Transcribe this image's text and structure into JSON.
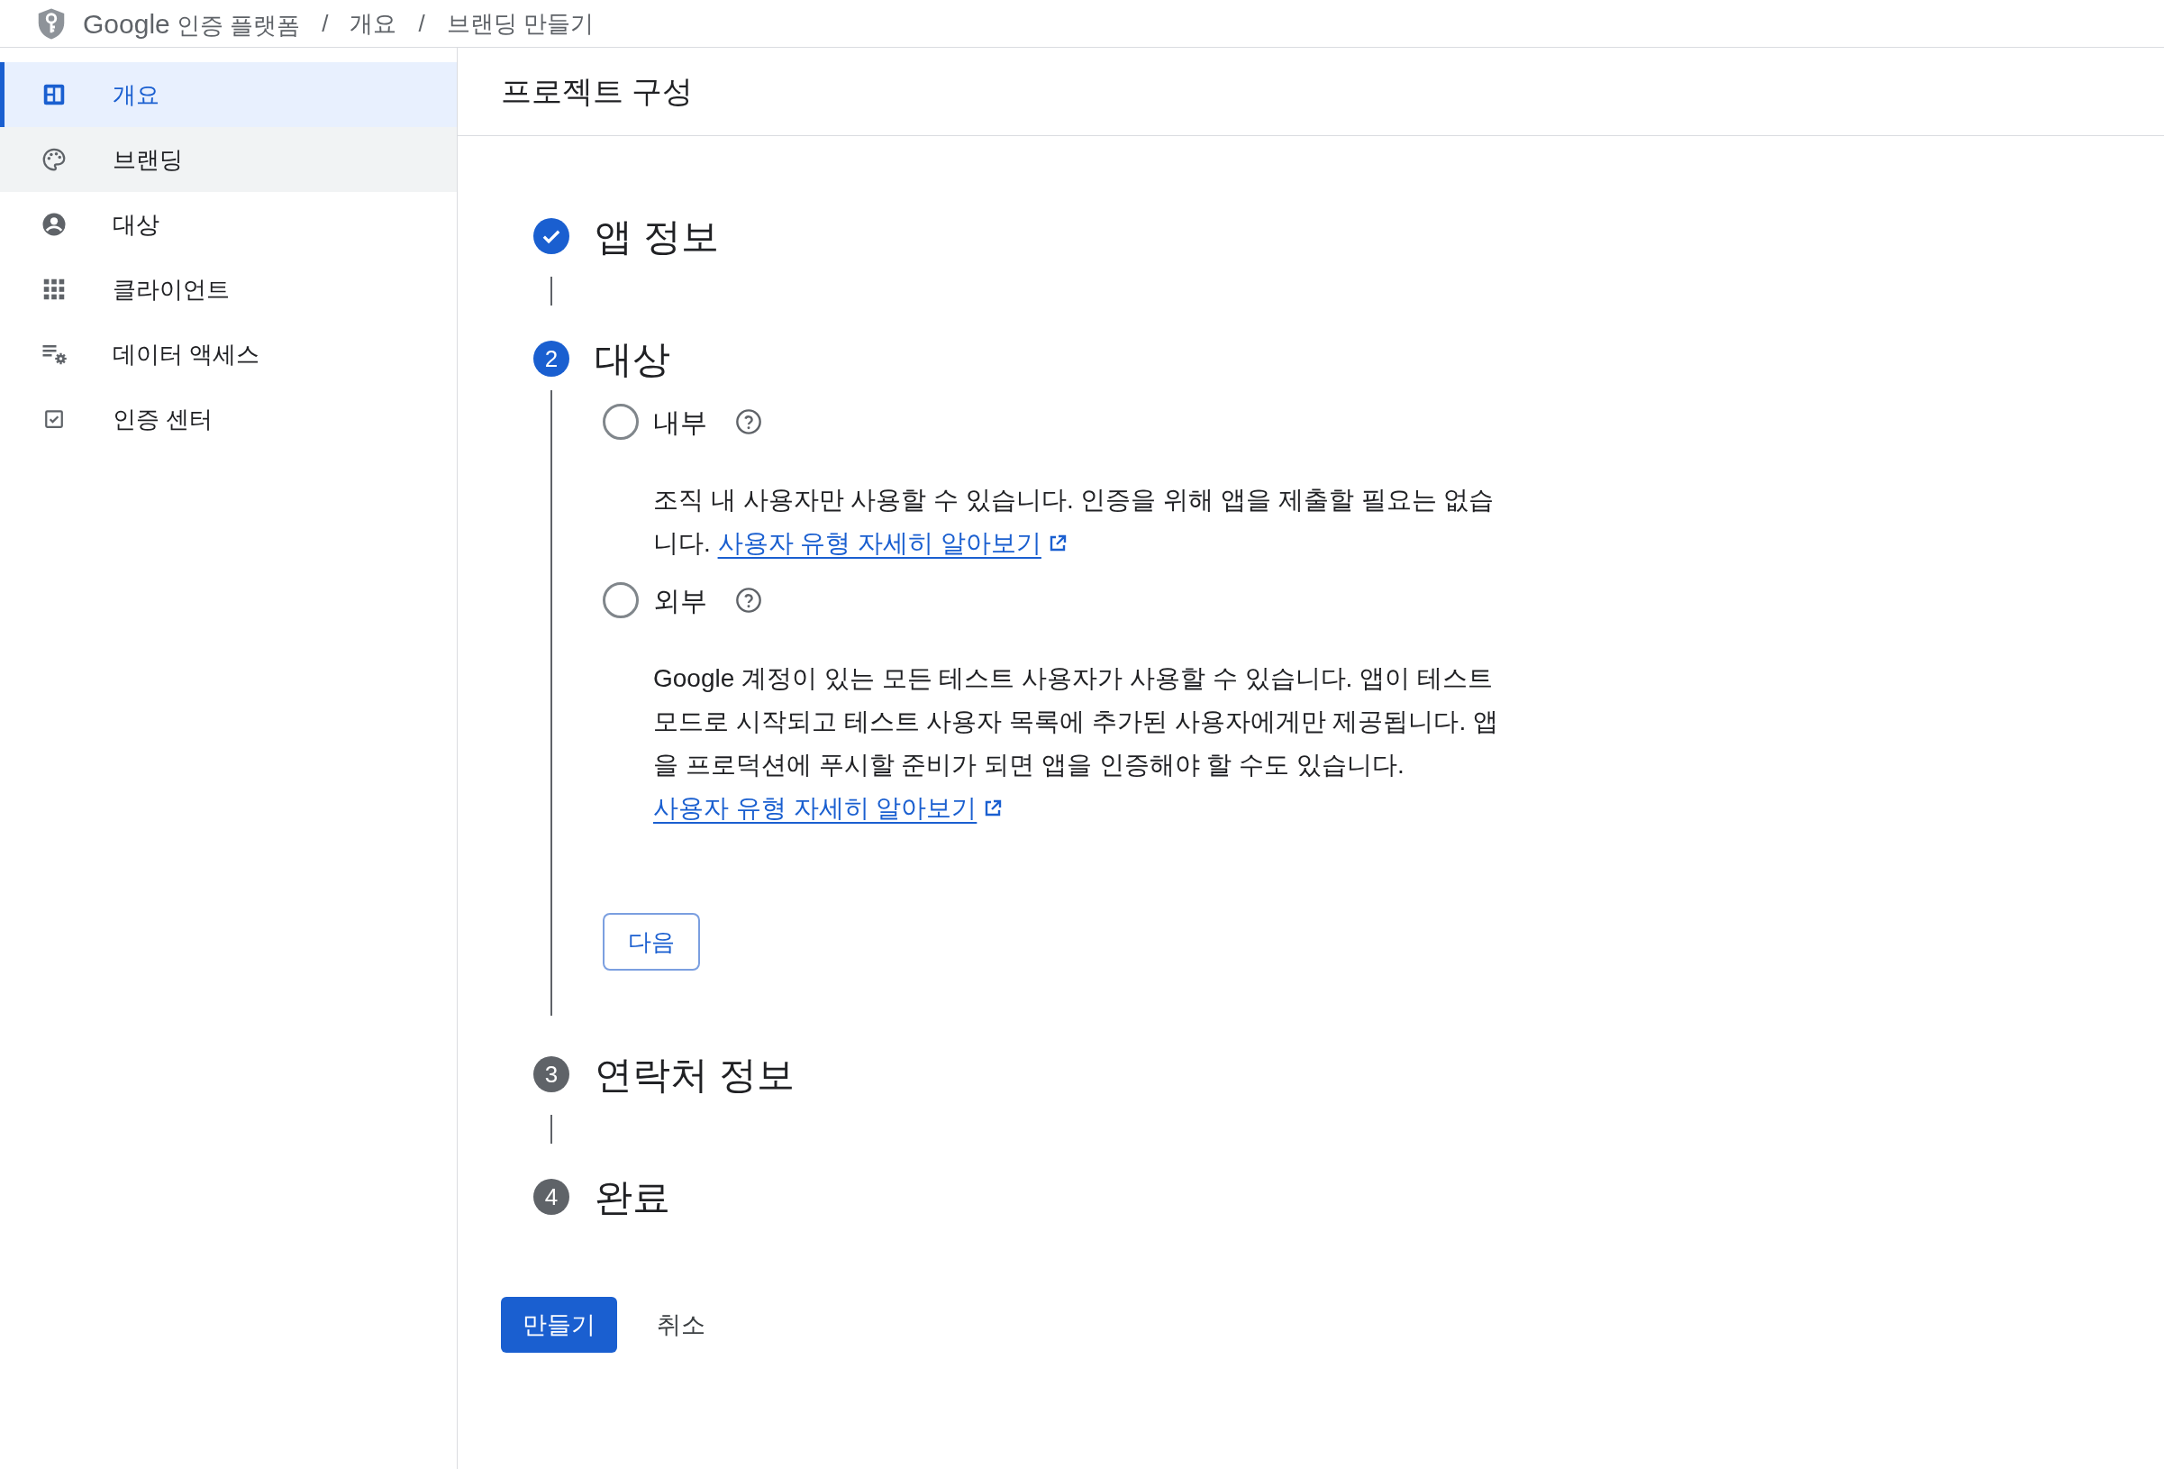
{
  "breadcrumb": {
    "brand": "Google",
    "product": "인증 플랫폼",
    "items": [
      "개요",
      "브랜딩 만들기"
    ],
    "separator": "/"
  },
  "sidebar": {
    "items": [
      {
        "label": "개요",
        "kind": "dashboard",
        "selected": true,
        "hovered": false
      },
      {
        "label": "브랜딩",
        "kind": "palette",
        "selected": false,
        "hovered": true
      },
      {
        "label": "대상",
        "kind": "person",
        "selected": false,
        "hovered": false
      },
      {
        "label": "클라이언트",
        "kind": "grid",
        "selected": false,
        "hovered": false
      },
      {
        "label": "데이터 액세스",
        "kind": "settings",
        "selected": false,
        "hovered": false
      },
      {
        "label": "인증 센터",
        "kind": "checkbox",
        "selected": false,
        "hovered": false
      }
    ]
  },
  "page_title": "프로젝트 구성",
  "steps": [
    {
      "title": "앱 정보",
      "kind": "done"
    },
    {
      "number": "2",
      "title": "대상",
      "kind": "active",
      "options": [
        {
          "label": "내부",
          "selected": false,
          "description": "조직 내 사용자만 사용할 수 있습니다. 인증을 위해 앱을 제출할 필요는 없습니다.",
          "link": "사용자 유형 자세히 알아보기"
        },
        {
          "label": "외부",
          "selected": false,
          "description": "Google 계정이 있는 모든 테스트 사용자가 사용할 수 있습니다. 앱이 테스트 모드로 시작되고 테스트 사용자 목록에 추가된 사용자에게만 제공됩니다. 앱을 프로덕션에 푸시할 준비가 되면 앱을 인증해야 할 수도 있습니다.",
          "link": "사용자 유형 자세히 알아보기"
        }
      ],
      "next_button": "다음"
    },
    {
      "number": "3",
      "title": "연락처 정보",
      "kind": "pending"
    },
    {
      "number": "4",
      "title": "완료",
      "kind": "pending"
    }
  ],
  "actions": {
    "primary": "만들기",
    "secondary": "취소"
  }
}
